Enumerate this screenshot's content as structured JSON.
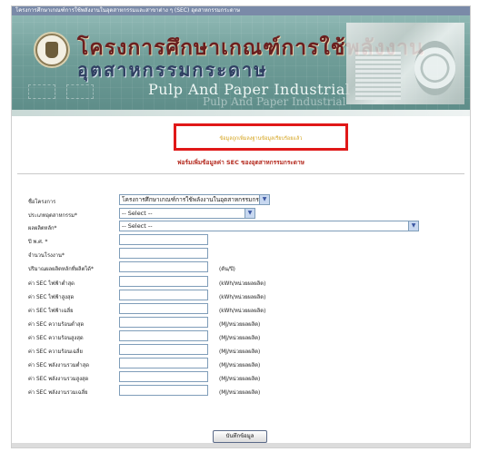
{
  "topbar": {
    "text": "โครงการศึกษาเกณฑ์การใช้พลังงานในอุตสาหกรรมและสาขาต่าง ๆ (SEC) อุตสาหกรรมกระดาษ"
  },
  "banner": {
    "title_line1": "โครงการศึกษาเกณฑ์การใช้พลังงาน",
    "title_line2": "อุตสาหกรรมกระดาษ",
    "title_en": "Pulp And Paper Industrial",
    "title_en_sub": "Pulp And Paper Industrial"
  },
  "message": {
    "text": "ข้อมูลถูกเพิ่มลงฐานข้อมูลเรียบร้อยแล้ว"
  },
  "form": {
    "title": "ฟอร์มเพิ่มข้อมูลค่า SEC ของอุตสาหกรรมกระดาษ",
    "fields": [
      {
        "label": "ชื่อโครงการ",
        "type": "select",
        "value": "โครงการศึกษาเกณฑ์การใช้พลังงานในอุตสาหกรรมกระดาษ"
      },
      {
        "label": "ประเภทอุตสาหกรรม*",
        "type": "select",
        "value": "-- Select --"
      },
      {
        "label": "ผลผลิตหลัก*",
        "type": "select",
        "value": "-- Select --"
      },
      {
        "label": "ปี พ.ศ. *",
        "type": "input",
        "value": ""
      },
      {
        "label": "จำนวนโรงงาน*",
        "type": "input",
        "value": ""
      },
      {
        "label": "ปริมาณผลผลิตหลักที่ผลิตได้*",
        "type": "input",
        "value": "",
        "unit": "(ตัน/ปี)"
      },
      {
        "label": "ค่า SEC ไฟฟ้าต่ำสุด",
        "type": "input",
        "value": "",
        "unit": "(kWh/หน่วยผลผลิต)"
      },
      {
        "label": "ค่า SEC ไฟฟ้าสูงสุด",
        "type": "input",
        "value": "",
        "unit": "(kWh/หน่วยผลผลิต)"
      },
      {
        "label": "ค่า SEC ไฟฟ้าเฉลี่ย",
        "type": "input",
        "value": "",
        "unit": "(kWh/หน่วยผลผลิต)"
      },
      {
        "label": "ค่า SEC ความร้อนต่ำสุด",
        "type": "input",
        "value": "",
        "unit": "(MJ/หน่วยผลผลิต)"
      },
      {
        "label": "ค่า SEC ความร้อนสูงสุด",
        "type": "input",
        "value": "",
        "unit": "(MJ/หน่วยผลผลิต)"
      },
      {
        "label": "ค่า SEC ความร้อนเฉลี่ย",
        "type": "input",
        "value": "",
        "unit": "(MJ/หน่วยผลผลิต)"
      },
      {
        "label": "ค่า SEC พลังงานรวมต่ำสุด",
        "type": "input",
        "value": "",
        "unit": "(MJ/หน่วยผลผลิต)"
      },
      {
        "label": "ค่า SEC พลังงานรวมสูงสุด",
        "type": "input",
        "value": "",
        "unit": "(MJ/หน่วยผลผลิต)"
      },
      {
        "label": "ค่า SEC พลังงานรวมเฉลี่ย",
        "type": "input",
        "value": "",
        "unit": "(MJ/หน่วยผลผลิต)"
      }
    ],
    "submit_label": "บันทึกข้อมูล"
  },
  "colors": {
    "message_border": "#e01818",
    "message_text": "#d4a21b",
    "form_title": "#b42a1f"
  }
}
